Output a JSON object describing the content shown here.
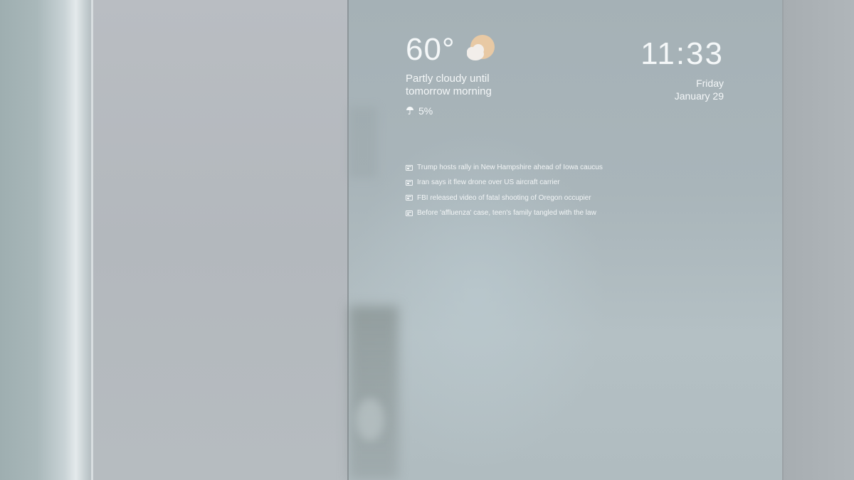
{
  "weather": {
    "temperature": "60°",
    "summary": "Partly cloudy until tomorrow morning",
    "precipitation": "5%",
    "icon": "partly-cloudy-icon",
    "precip_icon": "umbrella-icon"
  },
  "clock": {
    "time": "11:33",
    "day": "Friday",
    "date": "January 29"
  },
  "news": {
    "icon": "newspaper-icon",
    "headlines": [
      "Trump hosts rally in New Hampshire ahead of Iowa caucus",
      "Iran says it flew drone over US aircraft carrier",
      "FBI released video of fatal shooting of Oregon occupier",
      "Before 'affluenza' case, teen's family tangled with the law"
    ]
  },
  "colors": {
    "text": "#f4f7f8",
    "sun": "#e8c9a4",
    "cloud": "#f2eeea"
  }
}
